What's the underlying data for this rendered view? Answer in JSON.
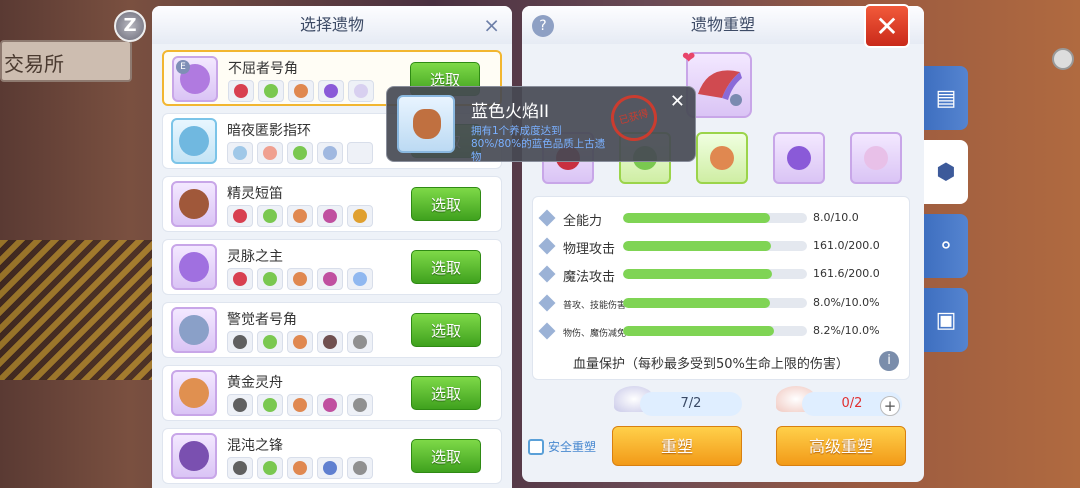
{
  "background": {
    "sign_text": "交易所",
    "z_label": "Z"
  },
  "left_panel": {
    "title": "选择遗物",
    "items": [
      {
        "name": "不屈者号角",
        "button": "选取",
        "badge": "E",
        "selected": true,
        "icon_color": "#b07ae0",
        "slots": [
          "#d84050",
          "#7ac850",
          "#e08850",
          "#8a5ad8",
          "#d8d0f0"
        ]
      },
      {
        "name": "暗夜匿影指环",
        "button": "选取",
        "selected": false,
        "icon_color": "#70b8e0",
        "slots": [
          "#a0c8e8",
          "#f0a090",
          "#7ac850",
          "#a0b8e0",
          ""
        ]
      },
      {
        "name": "精灵短笛",
        "button": "选取",
        "selected": false,
        "icon_color": "#a0583a",
        "slots": [
          "#d84050",
          "#7ac850",
          "#e08850",
          "#c050a0",
          "#e0a030"
        ]
      },
      {
        "name": "灵脉之主",
        "button": "选取",
        "selected": false,
        "icon_color": "#a070e0",
        "slots": [
          "#d84050",
          "#7ac850",
          "#e08850",
          "#c050a0",
          "#90b8f0"
        ]
      },
      {
        "name": "警觉者号角",
        "button": "选取",
        "selected": false,
        "icon_color": "#8aa0c8",
        "slots": [
          "#606060",
          "#7ac850",
          "#e08850",
          "#705050",
          "#909090"
        ]
      },
      {
        "name": "黄金灵舟",
        "button": "选取",
        "selected": false,
        "icon_color": "#e09050",
        "slots": [
          "#606060",
          "#7ac850",
          "#e08850",
          "#c050a0",
          "#909090"
        ]
      },
      {
        "name": "混沌之锋",
        "button": "选取",
        "selected": false,
        "icon_color": "#7a50b0",
        "slots": [
          "#606060",
          "#7ac850",
          "#e08850",
          "#6080d0",
          "#909090"
        ]
      }
    ]
  },
  "tooltip": {
    "name": "蓝色火焰II",
    "desc": "拥有1个养成度达到80%/80%的蓝色品质上古遗物",
    "stamp": "已获得"
  },
  "right_panel": {
    "title": "遗物重塑",
    "help": "?",
    "close": "✕",
    "parts": [
      {
        "color": "#c83040",
        "frame": "purple"
      },
      {
        "color": "#7ac850",
        "frame": "green"
      },
      {
        "color": "#e08850",
        "frame": "green"
      },
      {
        "color": "#8a5ad8",
        "frame": "purple"
      },
      {
        "color": "#e8c0e8",
        "frame": "purple"
      }
    ],
    "stats": [
      {
        "label": "全能力",
        "value": "8.0/10.0",
        "fill": 0.8,
        "small": false
      },
      {
        "label": "物理攻击",
        "value": "161.0/200.0",
        "fill": 0.805,
        "small": false
      },
      {
        "label": "魔法攻击",
        "value": "161.6/200.0",
        "fill": 0.808,
        "small": false
      },
      {
        "label": "普攻、技能伤害",
        "value": "8.0%/10.0%",
        "fill": 0.8,
        "small": true
      },
      {
        "label": "物伤、魔伤减免",
        "value": "8.2%/10.0%",
        "fill": 0.82,
        "small": true
      }
    ],
    "protect_text": "血量保护（每秒最多受到50%生命上限的伤害）",
    "info": "i",
    "material_1": "7/2",
    "material_2": "0/2",
    "plus": "+",
    "safe_label": "安全重塑",
    "reforge_button": "重塑",
    "adv_reforge_button": "高级重塑"
  },
  "side_tabs": [
    {
      "icon": "shop-icon",
      "glyph": "▤",
      "active": false
    },
    {
      "icon": "hexagon-icon",
      "glyph": "⬢",
      "active": true
    },
    {
      "icon": "nodes-icon",
      "glyph": "⚬",
      "active": false
    },
    {
      "icon": "frame-icon",
      "glyph": "▣",
      "active": false
    }
  ]
}
